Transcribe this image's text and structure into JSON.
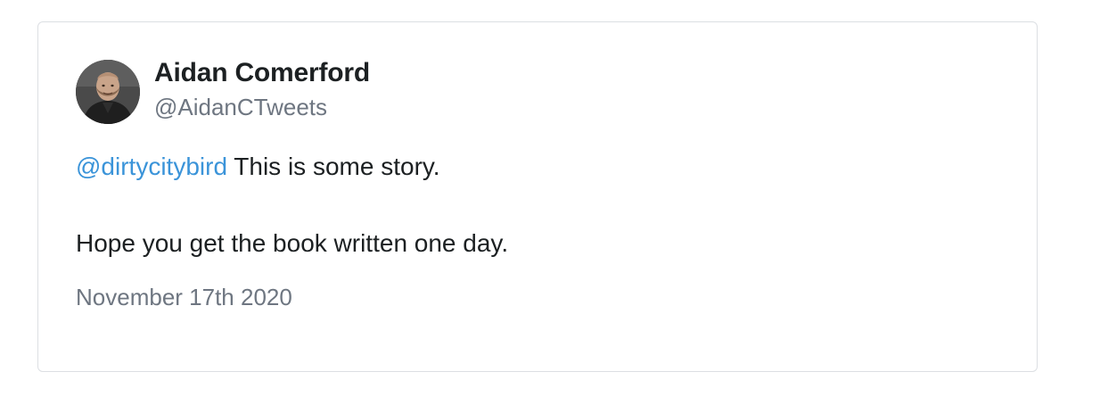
{
  "tweet": {
    "author": {
      "name": "Aidan Comerford",
      "handle": "@AidanCTweets"
    },
    "body": {
      "mention": "@dirtycitybird",
      "line1_text": " This is some story.",
      "line2_text": "Hope you get the book written one day."
    },
    "date": "November 17th 2020"
  },
  "colors": {
    "mention": "#3b94d9",
    "name": "#1c2022",
    "muted": "#6e7681",
    "border": "#dcdfe3"
  }
}
